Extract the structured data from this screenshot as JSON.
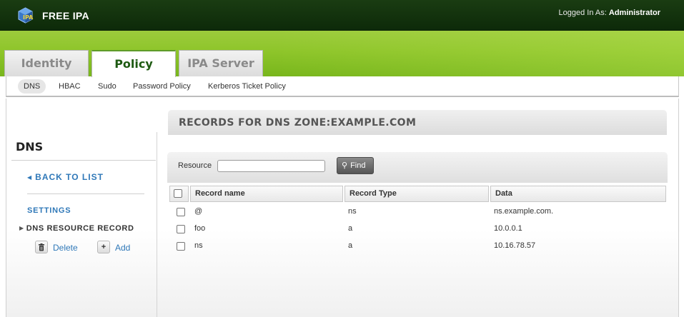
{
  "header": {
    "app_title": "FREE IPA",
    "logged_in_label": "Logged In As: ",
    "user": "Administrator"
  },
  "tabs": [
    {
      "label": "Identity",
      "active": false
    },
    {
      "label": "Policy",
      "active": true
    },
    {
      "label": "IPA Server",
      "active": false
    }
  ],
  "subnav": [
    "DNS",
    "HBAC",
    "Sudo",
    "Password Policy",
    "Kerberos Ticket Policy"
  ],
  "sidebar": {
    "title": "DNS",
    "back_link": "BACK TO LIST",
    "settings_link": "SETTINGS",
    "section": "DNS RESOURCE RECORD",
    "delete_label": "Delete",
    "add_label": "Add"
  },
  "content": {
    "title": "RECORDS FOR DNS ZONE:EXAMPLE.COM",
    "search_label": "Resource",
    "search_value": "",
    "find_label": "Find",
    "columns": [
      "Record name",
      "Record Type",
      "Data"
    ],
    "rows": [
      {
        "name": "@",
        "type": "ns",
        "data": "ns.example.com."
      },
      {
        "name": "foo",
        "type": "a",
        "data": "10.0.0.1"
      },
      {
        "name": "ns",
        "type": "a",
        "data": "10.16.78.57"
      }
    ]
  },
  "colors": {
    "header_dark_green": "#143510",
    "band_green": "#8ec52a",
    "active_tab_text": "#1e5a12",
    "link_blue": "#2f78b8"
  }
}
